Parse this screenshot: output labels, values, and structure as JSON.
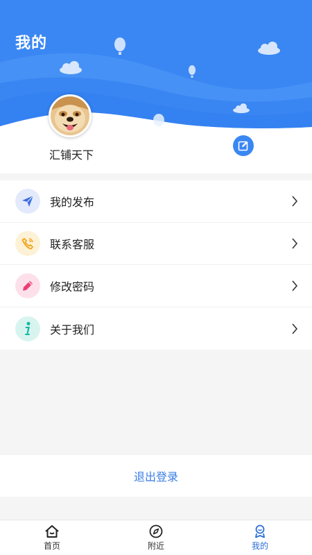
{
  "header": {
    "title": "我的",
    "bg_color": "#3a87f3"
  },
  "profile": {
    "username": "汇铺天下",
    "avatar_icon": "dog-avatar",
    "edit_icon": "edit-icon"
  },
  "menu": {
    "items": [
      {
        "label": "我的发布",
        "icon": "paper-plane-icon",
        "icon_color": "#3b6fe0",
        "icon_bg": "#e3eafc"
      },
      {
        "label": "联系客服",
        "icon": "phone-icon",
        "icon_color": "#f2a51a",
        "icon_bg": "#fdf1d6"
      },
      {
        "label": "修改密码",
        "icon": "pencil-icon",
        "icon_color": "#ec3f72",
        "icon_bg": "#fde0ea"
      },
      {
        "label": "关于我们",
        "icon": "info-icon",
        "icon_color": "#16b9a3",
        "icon_bg": "#d8f4ef"
      }
    ]
  },
  "logout": {
    "label": "退出登录",
    "color": "#3a7ee6"
  },
  "tabbar": {
    "tabs": [
      {
        "label": "首页",
        "icon": "home-icon",
        "active": false
      },
      {
        "label": "附近",
        "icon": "compass-icon",
        "active": false
      },
      {
        "label": "我的",
        "icon": "profile-badge-icon",
        "active": true
      }
    ]
  }
}
